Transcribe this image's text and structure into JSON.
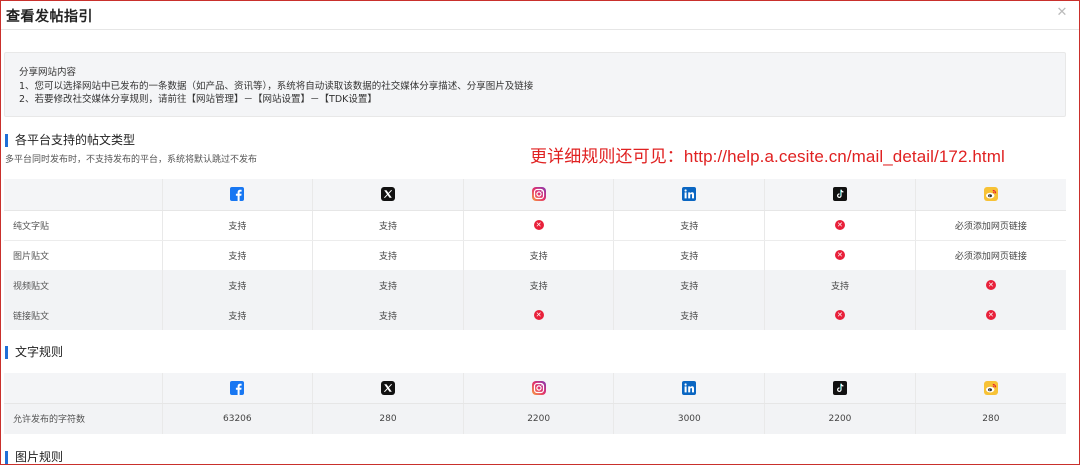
{
  "dialog": {
    "title": "查看发帖指引",
    "close_icon": "close-icon"
  },
  "notice": {
    "heading": "分享网站内容",
    "line1": "1、您可以选择网站中已发布的一条数据（如产品、资讯等），系统将自动读取该数据的社交媒体分享描述、分享图片及链接",
    "line2": "2、若要修改社交媒体分享规则，请前往【网站管理】－【网站设置】－【TDK设置】"
  },
  "section_post_types": {
    "title": "各平台支持的帖文类型",
    "subtitle": "多平台同时发布时，不支持发布的平台，系统将默认跳过不发布"
  },
  "red_note": "更详细规则还可见：http://help.a.cesite.cn/mail_detail/172.html",
  "platforms": [
    "facebook-icon",
    "x-icon",
    "instagram-icon",
    "linkedin-icon",
    "tiktok-icon",
    "weibo-icon"
  ],
  "colors": {
    "facebook": "#1877f2",
    "x": "#111111",
    "linkedin": "#0a66c2",
    "tiktok": "#111111",
    "unsupported": "#e8203a",
    "section_bar": "#1f6fd6",
    "note_red": "#e02121"
  },
  "post_types": {
    "rows": [
      {
        "label": "纯文字贴",
        "cells": [
          "支持",
          "支持",
          "",
          "支持",
          "",
          "必须添加网页链接"
        ]
      },
      {
        "label": "图片贴文",
        "cells": [
          "支持",
          "支持",
          "支持",
          "支持",
          "",
          "必须添加网页链接"
        ]
      },
      {
        "label": "视频贴文",
        "cells": [
          "支持",
          "支持",
          "支持",
          "支持",
          "支持",
          ""
        ]
      },
      {
        "label": "链接贴文",
        "cells": [
          "支持",
          "支持",
          "",
          "支持",
          "",
          ""
        ]
      }
    ],
    "unsupported_marker": "x-circle-icon"
  },
  "section_text_rules": {
    "title": "文字规则"
  },
  "text_rules": {
    "row_label": "允许发布的字符数",
    "values": [
      "63206",
      "280",
      "2200",
      "3000",
      "2200",
      "280"
    ]
  },
  "section_image_rules": {
    "title": "图片规则"
  }
}
